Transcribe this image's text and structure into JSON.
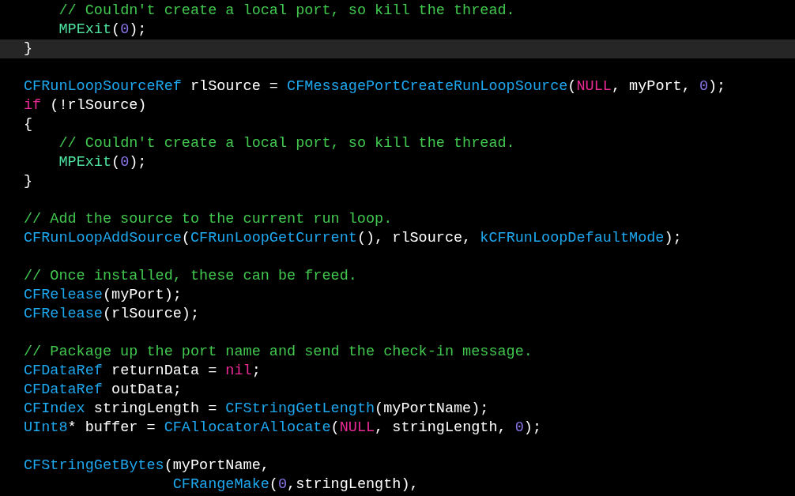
{
  "editor": {
    "lines": [
      {
        "current": false,
        "tokens": [
          {
            "kind": "comment",
            "text": "    // Couldn't create a local port, so kill the thread."
          }
        ]
      },
      {
        "current": false,
        "tokens": [
          {
            "kind": "macro",
            "text": "    MPExit"
          },
          {
            "kind": "plain",
            "text": "("
          },
          {
            "kind": "number",
            "text": "0"
          },
          {
            "kind": "plain",
            "text": ");"
          }
        ]
      },
      {
        "current": true,
        "tokens": [
          {
            "kind": "plain",
            "text": "}"
          }
        ]
      },
      {
        "current": false
      },
      {
        "current": false,
        "tokens": [
          {
            "kind": "type",
            "text": "CFRunLoopSourceRef"
          },
          {
            "kind": "plain",
            "text": " rlSource = "
          },
          {
            "kind": "type",
            "text": "CFMessagePortCreateRunLoopSource"
          },
          {
            "kind": "plain",
            "text": "("
          },
          {
            "kind": "keyword",
            "text": "NULL"
          },
          {
            "kind": "plain",
            "text": ", myPort, "
          },
          {
            "kind": "number",
            "text": "0"
          },
          {
            "kind": "plain",
            "text": ");"
          }
        ]
      },
      {
        "current": false,
        "tokens": [
          {
            "kind": "keyword",
            "text": "if"
          },
          {
            "kind": "plain",
            "text": " (!rlSource)"
          }
        ]
      },
      {
        "current": false,
        "tokens": [
          {
            "kind": "plain",
            "text": "{"
          }
        ]
      },
      {
        "current": false,
        "tokens": [
          {
            "kind": "comment",
            "text": "    // Couldn't create a local port, so kill the thread."
          }
        ]
      },
      {
        "current": false,
        "tokens": [
          {
            "kind": "macro",
            "text": "    MPExit"
          },
          {
            "kind": "plain",
            "text": "("
          },
          {
            "kind": "number",
            "text": "0"
          },
          {
            "kind": "plain",
            "text": ");"
          }
        ]
      },
      {
        "current": false,
        "tokens": [
          {
            "kind": "plain",
            "text": "}"
          }
        ]
      },
      {
        "current": false
      },
      {
        "current": false,
        "tokens": [
          {
            "kind": "comment",
            "text": "// Add the source to the current run loop."
          }
        ]
      },
      {
        "current": false,
        "tokens": [
          {
            "kind": "type",
            "text": "CFRunLoopAddSource"
          },
          {
            "kind": "plain",
            "text": "("
          },
          {
            "kind": "type",
            "text": "CFRunLoopGetCurrent"
          },
          {
            "kind": "plain",
            "text": "(), rlSource, "
          },
          {
            "kind": "type",
            "text": "kCFRunLoopDefaultMode"
          },
          {
            "kind": "plain",
            "text": ");"
          }
        ]
      },
      {
        "current": false
      },
      {
        "current": false,
        "tokens": [
          {
            "kind": "comment",
            "text": "// Once installed, these can be freed."
          }
        ]
      },
      {
        "current": false,
        "tokens": [
          {
            "kind": "type",
            "text": "CFRelease"
          },
          {
            "kind": "plain",
            "text": "(myPort);"
          }
        ]
      },
      {
        "current": false,
        "tokens": [
          {
            "kind": "type",
            "text": "CFRelease"
          },
          {
            "kind": "plain",
            "text": "(rlSource);"
          }
        ]
      },
      {
        "current": false
      },
      {
        "current": false,
        "tokens": [
          {
            "kind": "comment",
            "text": "// Package up the port name and send the check-in message."
          }
        ]
      },
      {
        "current": false,
        "tokens": [
          {
            "kind": "type",
            "text": "CFDataRef"
          },
          {
            "kind": "plain",
            "text": " returnData = "
          },
          {
            "kind": "keyword",
            "text": "nil"
          },
          {
            "kind": "plain",
            "text": ";"
          }
        ]
      },
      {
        "current": false,
        "tokens": [
          {
            "kind": "type",
            "text": "CFDataRef"
          },
          {
            "kind": "plain",
            "text": " outData;"
          }
        ]
      },
      {
        "current": false,
        "tokens": [
          {
            "kind": "type",
            "text": "CFIndex"
          },
          {
            "kind": "plain",
            "text": " stringLength = "
          },
          {
            "kind": "type",
            "text": "CFStringGetLength"
          },
          {
            "kind": "plain",
            "text": "(myPortName);"
          }
        ]
      },
      {
        "current": false,
        "tokens": [
          {
            "kind": "type",
            "text": "UInt8"
          },
          {
            "kind": "plain",
            "text": "* buffer = "
          },
          {
            "kind": "type",
            "text": "CFAllocatorAllocate"
          },
          {
            "kind": "plain",
            "text": "("
          },
          {
            "kind": "keyword",
            "text": "NULL"
          },
          {
            "kind": "plain",
            "text": ", stringLength, "
          },
          {
            "kind": "number",
            "text": "0"
          },
          {
            "kind": "plain",
            "text": ");"
          }
        ]
      },
      {
        "current": false
      },
      {
        "current": false,
        "tokens": [
          {
            "kind": "type",
            "text": "CFStringGetBytes"
          },
          {
            "kind": "plain",
            "text": "(myPortName,"
          }
        ]
      },
      {
        "current": false,
        "tokens": [
          {
            "kind": "type",
            "text": "                 CFRangeMake"
          },
          {
            "kind": "plain",
            "text": "("
          },
          {
            "kind": "number",
            "text": "0"
          },
          {
            "kind": "plain",
            "text": ",stringLength),"
          }
        ]
      }
    ]
  }
}
